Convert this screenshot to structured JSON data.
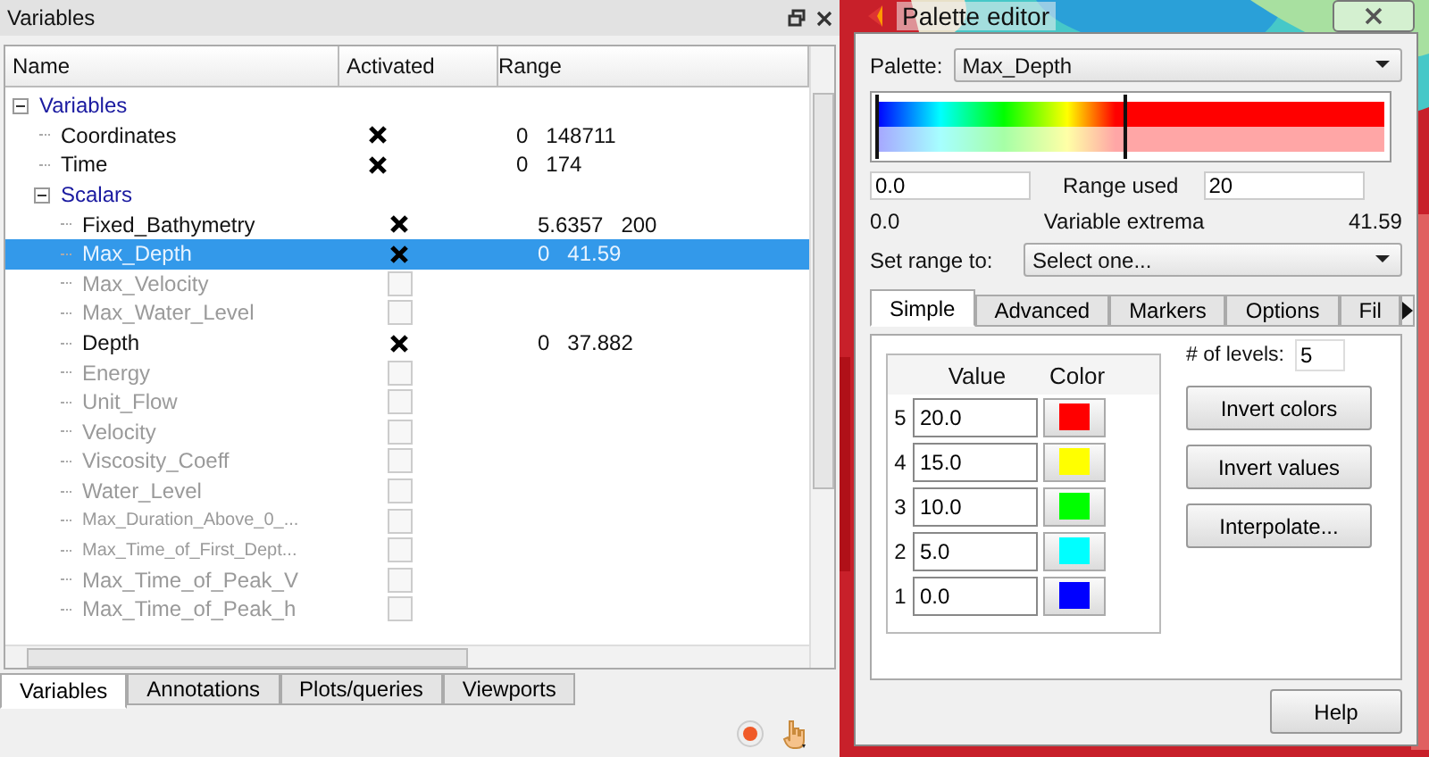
{
  "variables_panel": {
    "title": "Variables",
    "columns": [
      "Name",
      "Activated",
      "Range"
    ],
    "tree": [
      {
        "label": "Variables",
        "kind": "group",
        "expanded": true,
        "selected": false,
        "children": [
          {
            "label": "Coordinates",
            "kind": "variable",
            "checked": true,
            "enabled": true,
            "range": "0   148711",
            "selected": false
          },
          {
            "label": "Time",
            "kind": "variable",
            "checked": true,
            "enabled": true,
            "range": "0   174",
            "selected": false
          },
          {
            "label": "Scalars",
            "kind": "group",
            "expanded": true,
            "selected": false,
            "children": [
              {
                "label": "Fixed_Bathymetry",
                "kind": "variable",
                "checked": true,
                "enabled": true,
                "range": "5.6357   200",
                "selected": false
              },
              {
                "label": "Max_Depth",
                "kind": "variable",
                "checked": true,
                "enabled": true,
                "range": "0   41.59",
                "selected": true
              },
              {
                "label": "Max_Velocity",
                "kind": "variable",
                "checked": false,
                "enabled": false,
                "selected": false
              },
              {
                "label": "Max_Water_Level",
                "kind": "variable",
                "checked": false,
                "enabled": false,
                "selected": false
              },
              {
                "label": "Depth",
                "kind": "variable",
                "checked": true,
                "enabled": true,
                "range": "0   37.882",
                "selected": false
              },
              {
                "label": "Energy",
                "kind": "variable",
                "checked": false,
                "enabled": false,
                "selected": false
              },
              {
                "label": "Unit_Flow",
                "kind": "variable",
                "checked": false,
                "enabled": false,
                "selected": false
              },
              {
                "label": "Velocity",
                "kind": "variable",
                "checked": false,
                "enabled": false,
                "selected": false
              },
              {
                "label": "Viscosity_Coeff",
                "kind": "variable",
                "checked": false,
                "enabled": false,
                "selected": false
              },
              {
                "label": "Water_Level",
                "kind": "variable",
                "checked": false,
                "enabled": false,
                "selected": false
              },
              {
                "label": "Max_Duration_Above_0_...",
                "kind": "variable",
                "small": true,
                "checked": false,
                "enabled": false,
                "selected": false
              },
              {
                "label": "Max_Time_of_First_Dept...",
                "kind": "variable",
                "small": true,
                "checked": false,
                "enabled": false,
                "selected": false
              },
              {
                "label": "Max_Time_of_Peak_V",
                "kind": "variable",
                "checked": false,
                "enabled": false,
                "selected": false
              },
              {
                "label": "Max_Time_of_Peak_h",
                "kind": "variable",
                "checked": false,
                "enabled": false,
                "selected": false
              }
            ]
          }
        ]
      }
    ],
    "tabs": [
      {
        "label": "Variables",
        "selected": true
      },
      {
        "label": "Annotations",
        "selected": false
      },
      {
        "label": "Plots/queries",
        "selected": false
      },
      {
        "label": "Viewports",
        "selected": false
      }
    ]
  },
  "palette_editor": {
    "title": "Palette editor",
    "palette_label": "Palette:",
    "palette": "Max_Depth",
    "range_min": "0.0",
    "range_used_label": "Range used",
    "range_max": "20",
    "extrema_min": "0.0",
    "extrema_label": "Variable extrema",
    "extrema_max": "41.59",
    "set_range_label": "Set range to:",
    "set_range": "Select one...",
    "tabs": [
      {
        "label": "Simple",
        "selected": true
      },
      {
        "label": "Advanced",
        "selected": false
      },
      {
        "label": "Markers",
        "selected": false
      },
      {
        "label": "Options",
        "selected": false
      },
      {
        "label": "Fil",
        "selected": false
      }
    ],
    "table_columns": [
      "Value",
      "Color"
    ],
    "levels": [
      {
        "index": "5",
        "value": "20.0",
        "color": "#ff0000"
      },
      {
        "index": "4",
        "value": "15.0",
        "color": "#ffff00"
      },
      {
        "index": "3",
        "value": "10.0",
        "color": "#00ff00"
      },
      {
        "index": "2",
        "value": "5.0",
        "color": "#00ffff"
      },
      {
        "index": "1",
        "value": "0.0",
        "color": "#0000ff"
      }
    ],
    "levels_label": "# of levels:",
    "levels_count": "5",
    "buttons": [
      "Invert colors",
      "Invert values",
      "Interpolate..."
    ],
    "help": "Help"
  }
}
